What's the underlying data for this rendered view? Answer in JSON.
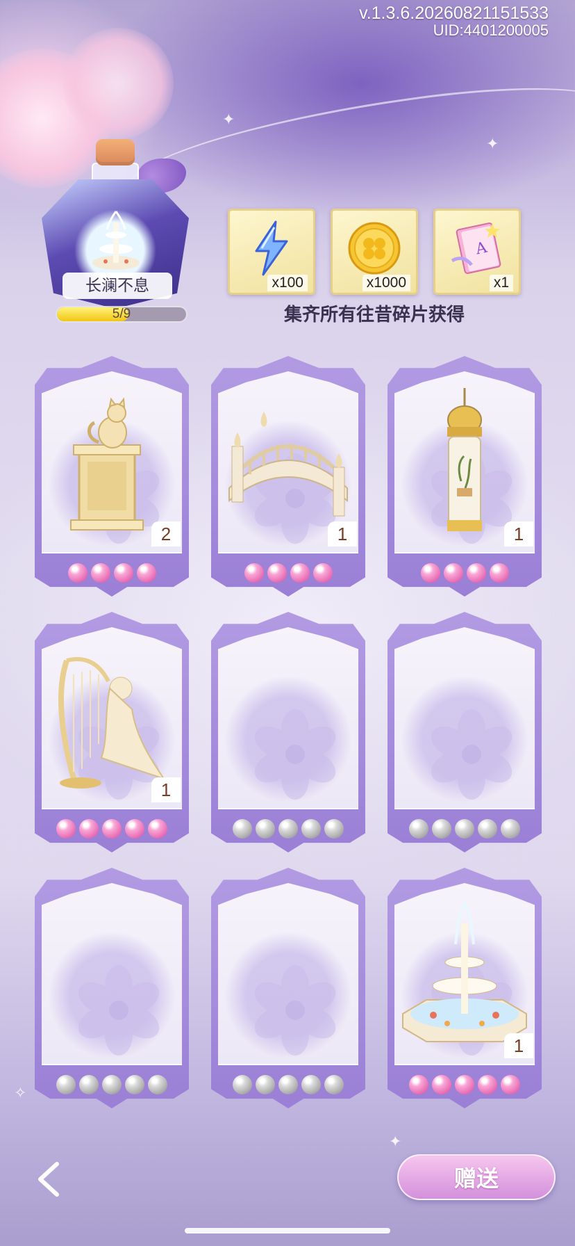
{
  "version": {
    "build": "v.1.3.6.20260821151533",
    "uid": "UID:4401200005"
  },
  "collection": {
    "name": "长澜不息",
    "progress_text": "5/9",
    "progress": 0.556
  },
  "rewards": [
    {
      "icon": "lightning-icon",
      "qty": "x100"
    },
    {
      "icon": "gold-clover-coin-icon",
      "qty": "x1000"
    },
    {
      "icon": "letter-book-icon",
      "qty": "x1"
    }
  ],
  "rewards_caption": "集齐所有往昔碎片获得",
  "cards": [
    {
      "item": "cat-statue",
      "count": "2",
      "pearls": [
        "pink",
        "pink",
        "pink",
        "pink"
      ]
    },
    {
      "item": "bridge",
      "count": "1",
      "pearls": [
        "pink",
        "pink",
        "pink",
        "pink"
      ]
    },
    {
      "item": "tower",
      "count": "1",
      "pearls": [
        "pink",
        "pink",
        "pink",
        "pink"
      ]
    },
    {
      "item": "harp-lady-statue",
      "count": "1",
      "pearls": [
        "pink",
        "pink",
        "pink",
        "pink",
        "pink"
      ]
    },
    {
      "item": "",
      "count": "",
      "pearls": [
        "gray",
        "gray",
        "gray",
        "gray",
        "gray"
      ]
    },
    {
      "item": "",
      "count": "",
      "pearls": [
        "gray",
        "gray",
        "gray",
        "gray",
        "gray"
      ]
    },
    {
      "item": "",
      "count": "",
      "pearls": [
        "gray",
        "gray",
        "gray",
        "gray",
        "gray"
      ]
    },
    {
      "item": "",
      "count": "",
      "pearls": [
        "gray",
        "gray",
        "gray",
        "gray",
        "gray"
      ]
    },
    {
      "item": "fountain",
      "count": "1",
      "pearls": [
        "pink",
        "pink",
        "pink",
        "pink",
        "pink"
      ]
    }
  ],
  "buttons": {
    "send": "赠送",
    "back_icon": "chevron-left-icon"
  }
}
